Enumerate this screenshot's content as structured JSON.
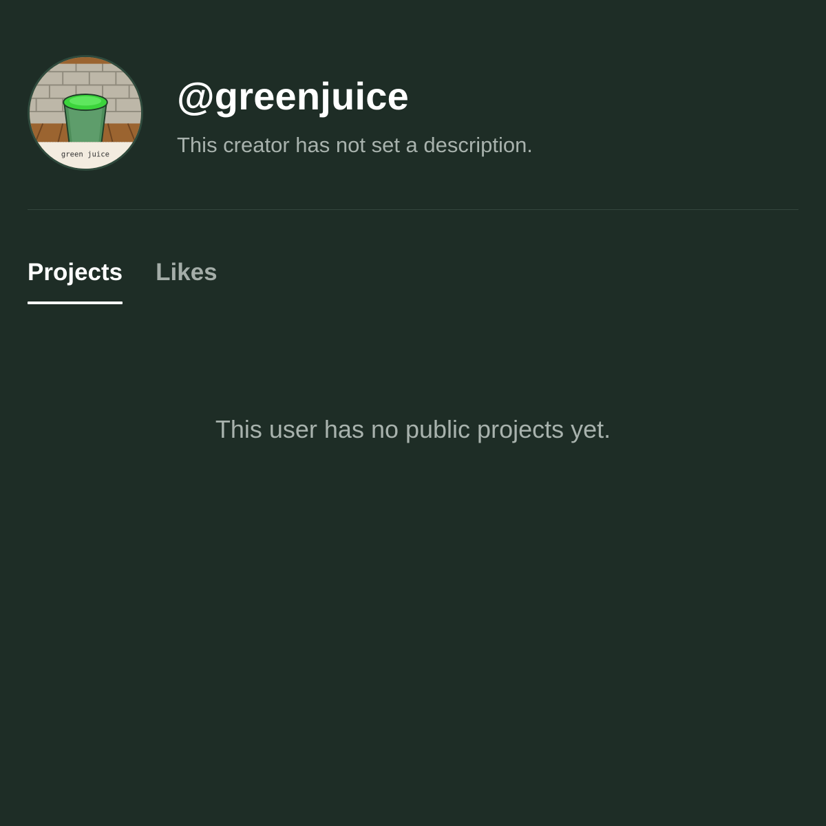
{
  "profile": {
    "username": "@greenjuice",
    "description": "This creator has not set a description.",
    "avatar": {
      "caption": "green juice",
      "colors": {
        "brick": "#bdb7a8",
        "mortar": "#8f8a7c",
        "table": "#9b6430",
        "cup": "#4d8d5a",
        "juice": "#3cd43c",
        "label": "#f3ece0"
      }
    }
  },
  "tabs": [
    {
      "label": "Projects",
      "active": true
    },
    {
      "label": "Likes",
      "active": false
    }
  ],
  "empty_state": {
    "message": "This user has no public projects yet."
  },
  "theme": {
    "background": "#1e2d26",
    "text_primary": "#ffffff",
    "text_muted": "#a8b2ad",
    "divider": "#34473e"
  }
}
